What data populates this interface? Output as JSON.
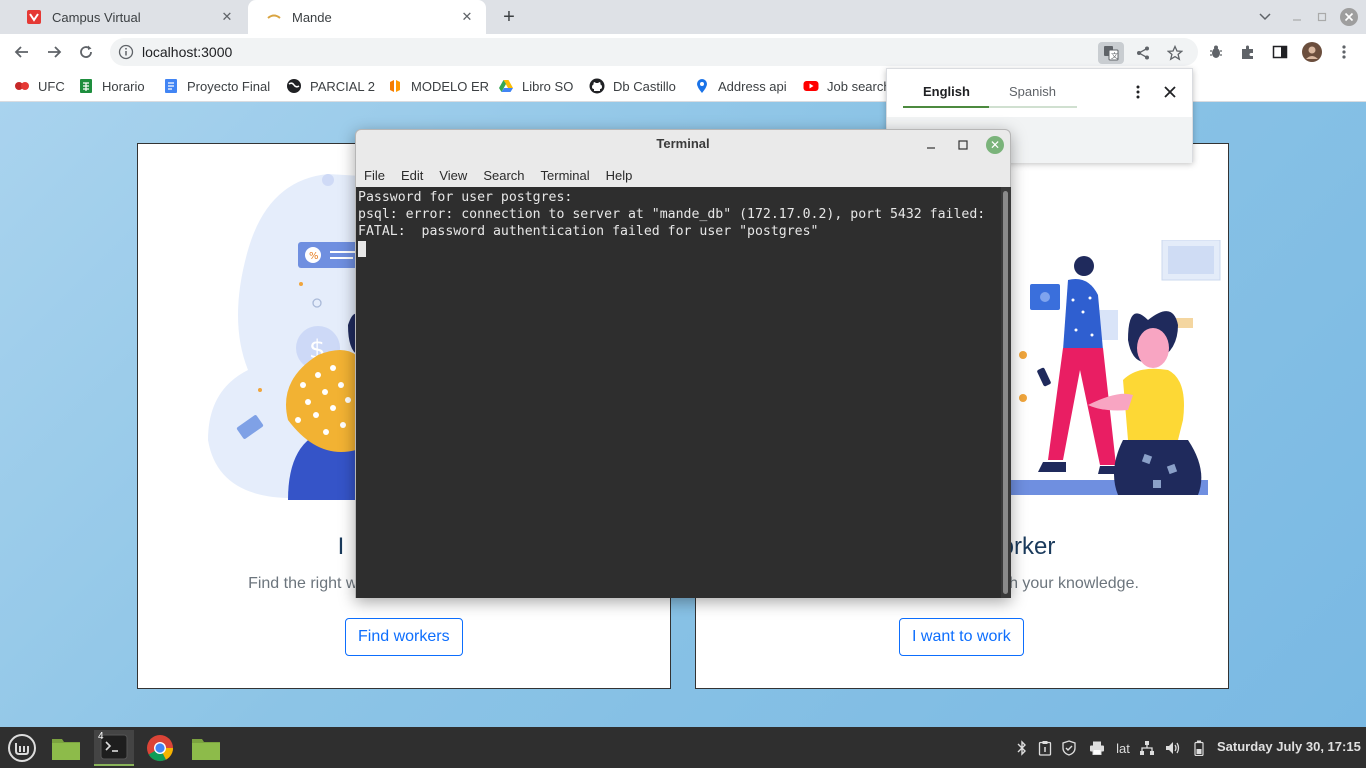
{
  "browser": {
    "tabs": [
      {
        "title": "Campus Virtual",
        "icon": "campus-virtual-favicon",
        "active": false
      },
      {
        "title": "Mande",
        "icon": "mande-favicon",
        "active": true
      }
    ],
    "new_tab_symbol": "+",
    "url": "localhost:3000",
    "bookmarks": [
      {
        "label": "UFC",
        "icon": "ufc-icon"
      },
      {
        "label": "Horario",
        "icon": "google-sheets-icon"
      },
      {
        "label": "Proyecto Final",
        "icon": "google-docs-icon"
      },
      {
        "label": "PARCIAL 2",
        "icon": "globe-icon"
      },
      {
        "label": "MODELO ER",
        "icon": "lucidchart-icon"
      },
      {
        "label": "Libro SO",
        "icon": "google-drive-icon"
      },
      {
        "label": "Db Castillo",
        "icon": "github-icon"
      },
      {
        "label": "Address api",
        "icon": "map-pin-icon"
      },
      {
        "label": "Job search",
        "icon": "youtube-icon"
      }
    ]
  },
  "translate_popup": {
    "languages": [
      "English",
      "Spanish"
    ],
    "selected": "English"
  },
  "page": {
    "cards": [
      {
        "heading": "I",
        "description": "Find the right worker",
        "button": "Find workers"
      },
      {
        "heading": "orker",
        "description": "y with your knowledge.",
        "button": "I want to work"
      }
    ]
  },
  "terminal": {
    "title": "Terminal",
    "menu": [
      "File",
      "Edit",
      "View",
      "Search",
      "Terminal",
      "Help"
    ],
    "lines": [
      "Password for user postgres:",
      "psql: error: connection to server at \"mande_db\" (172.17.0.2), port 5432 failed:",
      "FATAL:  password authentication failed for user \"postgres\""
    ]
  },
  "taskbar": {
    "terminal_badge": "4",
    "keyboard_layout": "lat",
    "clock": "Saturday July 30, 17:15"
  }
}
